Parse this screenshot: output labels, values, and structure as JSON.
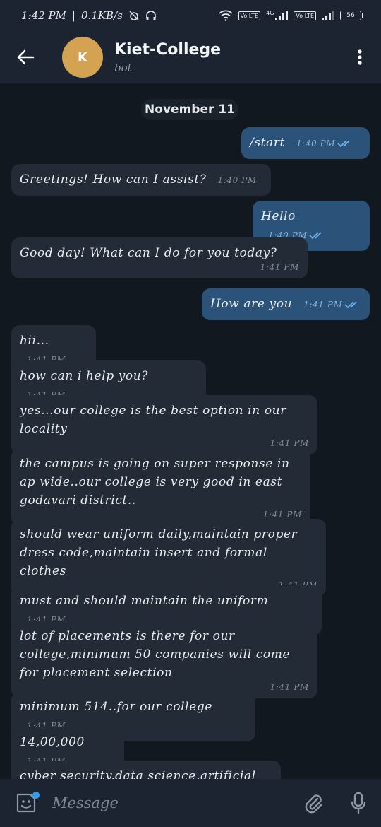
{
  "status_bar": {
    "time": "1:42 PM",
    "network_speed": "0.1KB/s",
    "network_type": "4G",
    "volte_1": "Vo LTE",
    "volte_2": "Vo LTE",
    "battery": "56"
  },
  "header": {
    "title": "Kiet-College",
    "subtitle": "bot",
    "avatar_letter": "K",
    "avatar_color": "#d4a351"
  },
  "date_label": "November 11",
  "messages": [
    {
      "dir": "out",
      "text": "/start",
      "time": "1:40 PM",
      "read": true
    },
    {
      "dir": "in",
      "text": "Greetings! How can I assist?",
      "time": "1:40 PM"
    },
    {
      "dir": "out",
      "text": "Hello",
      "time": "1:40 PM",
      "read": true
    },
    {
      "dir": "in",
      "text": "Good day! What can I do for you today?",
      "time": "1:41 PM"
    },
    {
      "dir": "out",
      "text": "How are you",
      "time": "1:41 PM",
      "read": true
    },
    {
      "dir": "in",
      "text": "hii...",
      "time": "1:41 PM"
    },
    {
      "dir": "in",
      "text": "how can i help you?",
      "time": "1:41 PM"
    },
    {
      "dir": "in",
      "text": "yes...our college is the best option  in our locality",
      "time": "1:41 PM"
    },
    {
      "dir": "in",
      "text": "the campus is going on super response in ap wide..our college is very good in east godavari district..",
      "time": "1:41 PM"
    },
    {
      "dir": "in",
      "text": "should wear uniform daily,maintain proper dress code,maintain insert and formal clothes",
      "time": "1:41 PM"
    },
    {
      "dir": "in",
      "text": "must and should maintain the uniform",
      "time": "1:41 PM"
    },
    {
      "dir": "in",
      "text": "lot of placements is there for our college,minimum 50 companies will come for placement selection",
      "time": "1:41 PM"
    },
    {
      "dir": "in",
      "text": "minimum 514..for our college",
      "time": "1:41 PM"
    },
    {
      "dir": "in",
      "text": "14,00,000",
      "time": "1:41 PM"
    },
    {
      "dir": "in",
      "text": "cyber security,data science,artificial",
      "time": ""
    }
  ],
  "composer": {
    "placeholder": "Message"
  },
  "colors": {
    "background": "#111820",
    "bar": "#1b2430",
    "incoming_bubble": "#222b36",
    "outgoing_bubble": "#2b5278",
    "accent": "#3a9be8"
  },
  "icons": {
    "back": "arrow-left-icon",
    "menu": "more-vert-icon",
    "emoji": "sticker-icon",
    "attach": "paperclip-icon",
    "mic": "microphone-icon",
    "read": "double-check-icon"
  }
}
